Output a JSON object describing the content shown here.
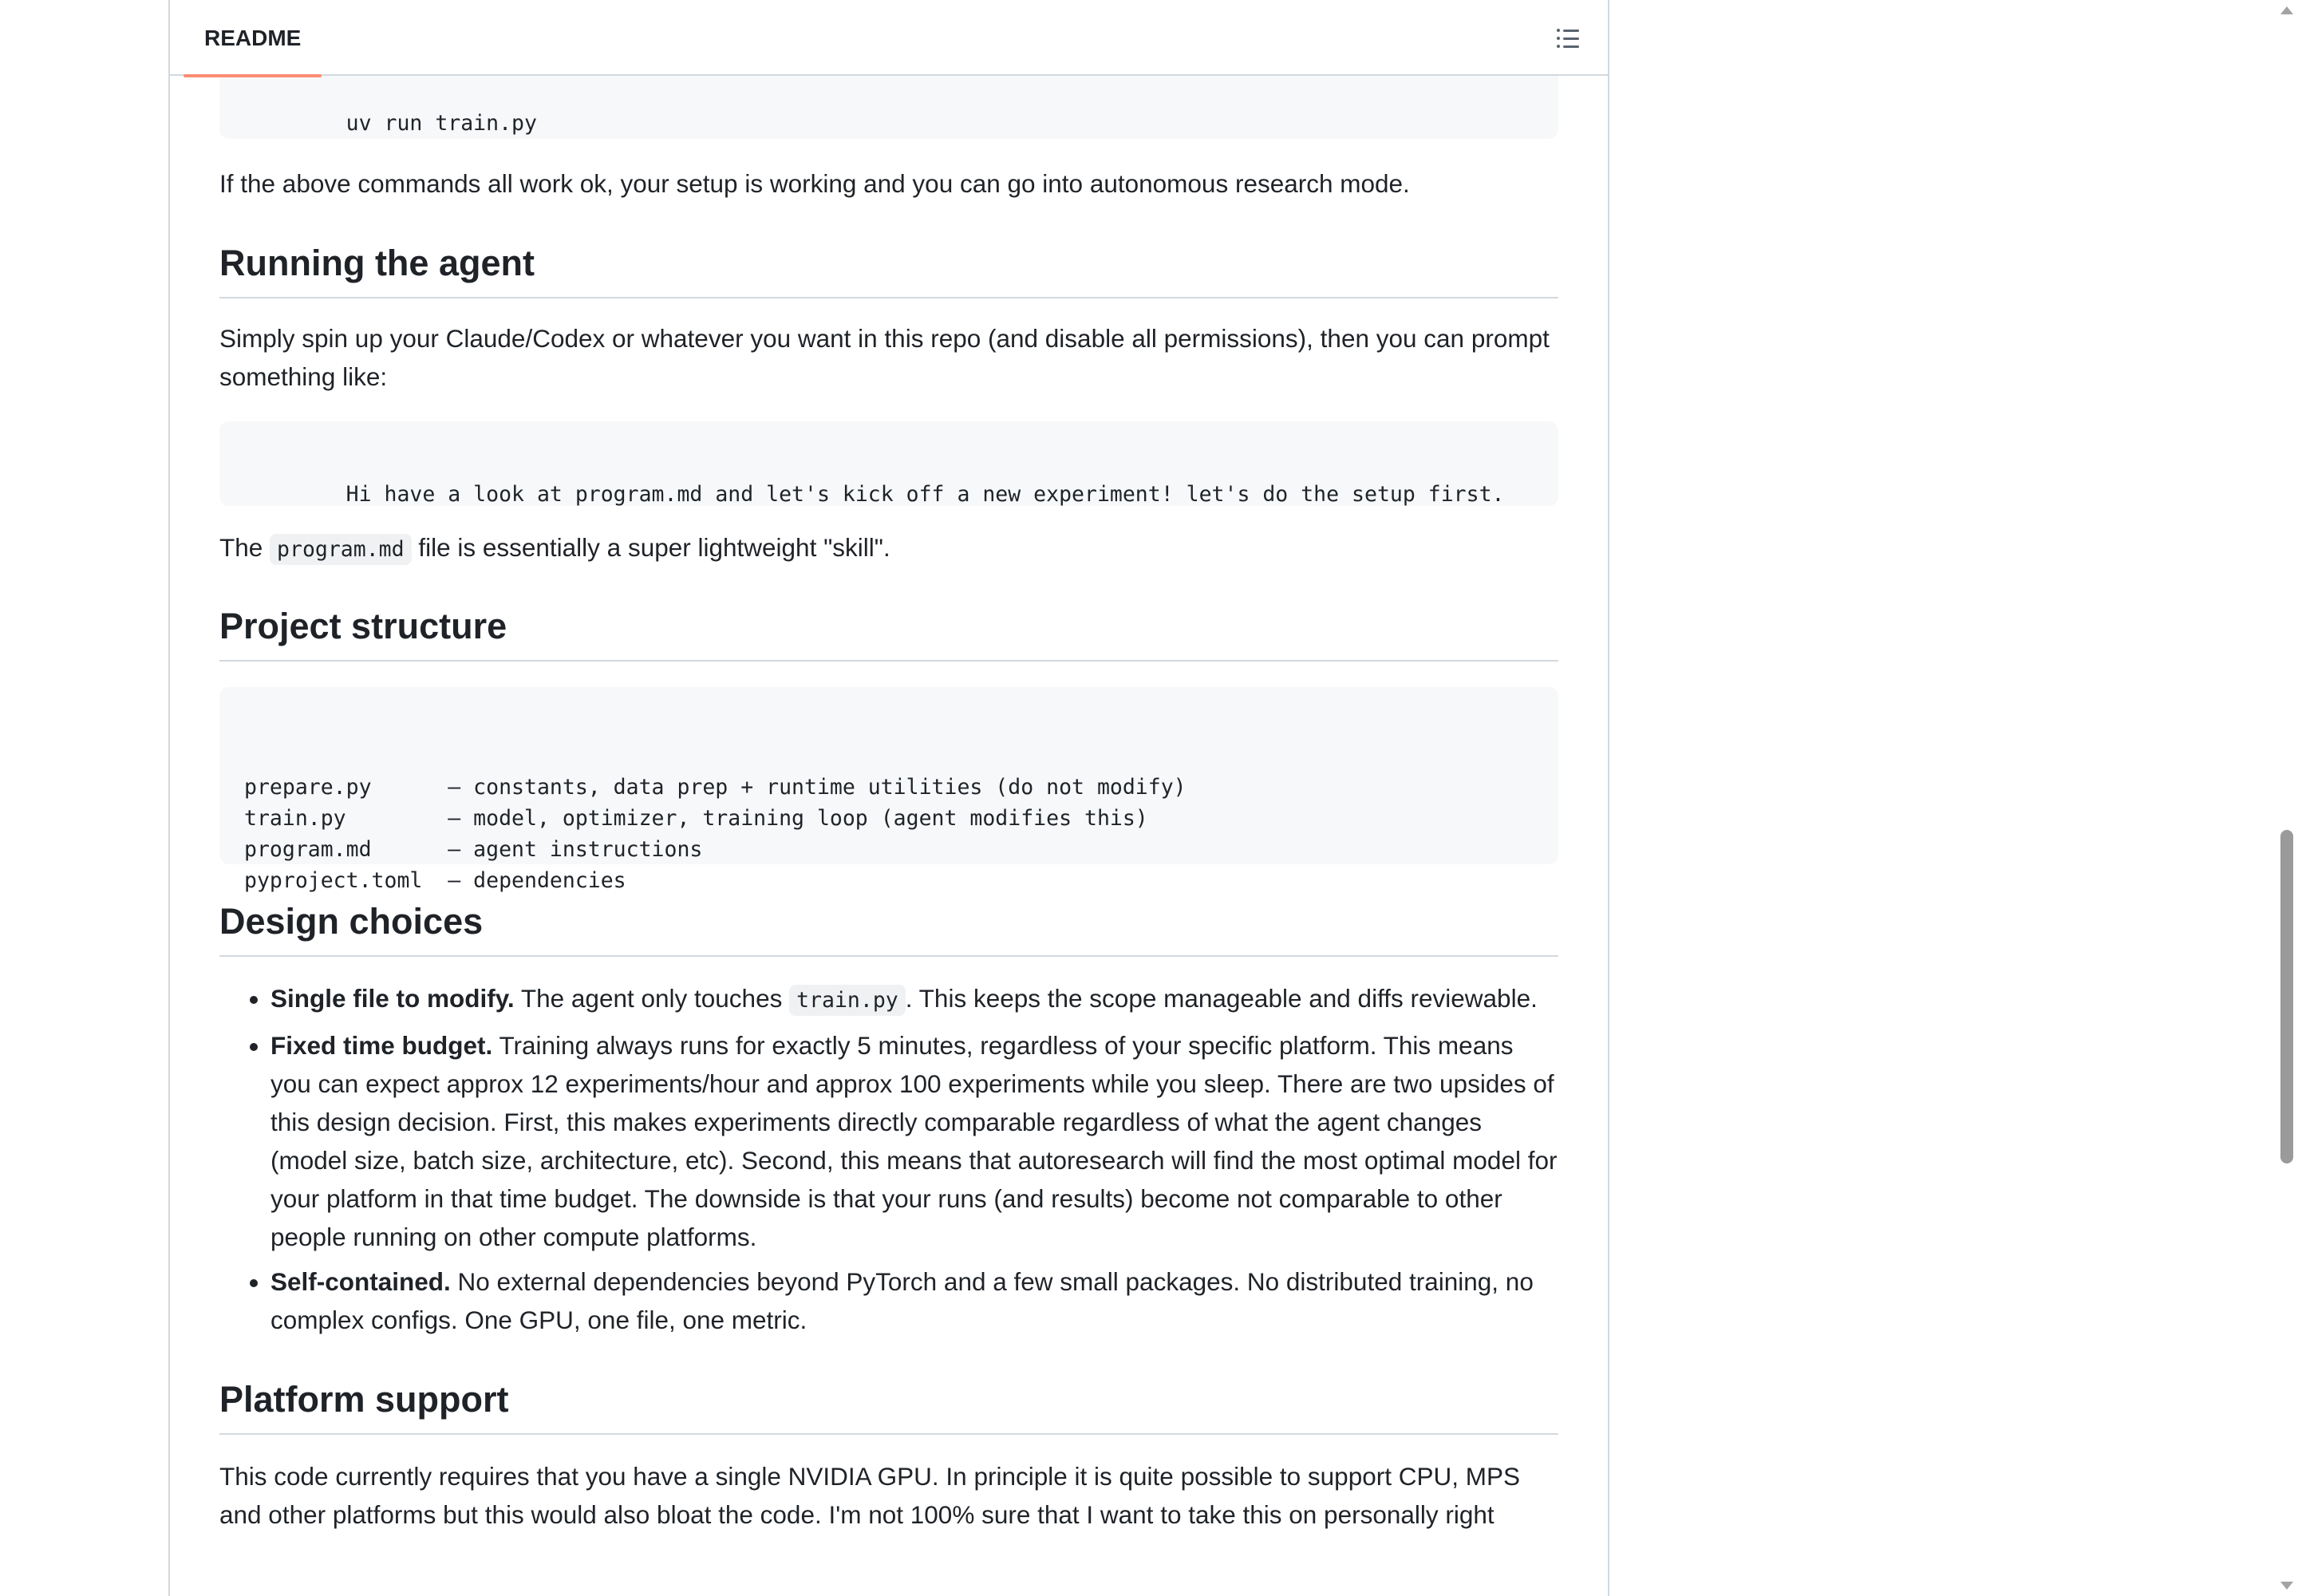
{
  "readme": {
    "tab_label": "README",
    "outline_icon": "list-unordered-icon"
  },
  "content": {
    "top_code": "uv run train.py",
    "setup_note": "If the above commands all work ok, your setup is working and you can go into autonomous research mode.",
    "running_heading": "Running the agent",
    "running_text": "Simply spin up your Claude/Codex or whatever you want in this repo (and disable all permissions), then you can prompt something like:",
    "prompt_code": "Hi have a look at program.md and let's kick off a new experiment! let's do the setup first.",
    "program_sentence": {
      "before": "The ",
      "code": "program.md",
      "after": " file is essentially a super lightweight \"skill\"."
    },
    "structure_heading": "Project structure",
    "structure_code": "prepare.py      — constants, data prep + runtime utilities (do not modify)\ntrain.py        — model, optimizer, training loop (agent modifies this)\nprogram.md      — agent instructions\npyproject.toml  — dependencies",
    "design_heading": "Design choices",
    "design_items": [
      {
        "title": "Single file to modify.",
        "before": " The agent only touches ",
        "code": "train.py",
        "after": ". This keeps the scope manageable and diffs reviewable."
      },
      {
        "title": "Fixed time budget.",
        "text": " Training always runs for exactly 5 minutes, regardless of your specific platform. This means you can expect approx 12 experiments/hour and approx 100 experiments while you sleep. There are two upsides of this design decision. First, this makes experiments directly comparable regardless of what the agent changes (model size, batch size, architecture, etc). Second, this means that autoresearch will find the most optimal model for your platform in that time budget. The downside is that your runs (and results) become not comparable to other people running on other compute platforms."
      },
      {
        "title": "Self-contained.",
        "text": " No external dependencies beyond PyTorch and a few small packages. No distributed training, no complex configs. One GPU, one file, one metric."
      }
    ],
    "platform_heading": "Platform support",
    "platform_text": "This code currently requires that you have a single NVIDIA GPU. In principle it is quite possible to support CPU, MPS and other platforms but this would also bloat the code. I'm not 100% sure that I want to take this on personally right"
  },
  "icons": {
    "copy": "copy-icon"
  },
  "colors": {
    "tab_underline": "#fd8c73",
    "code_bg": "#f6f8fa",
    "border": "#d1d9e0",
    "text": "#1f2328"
  }
}
